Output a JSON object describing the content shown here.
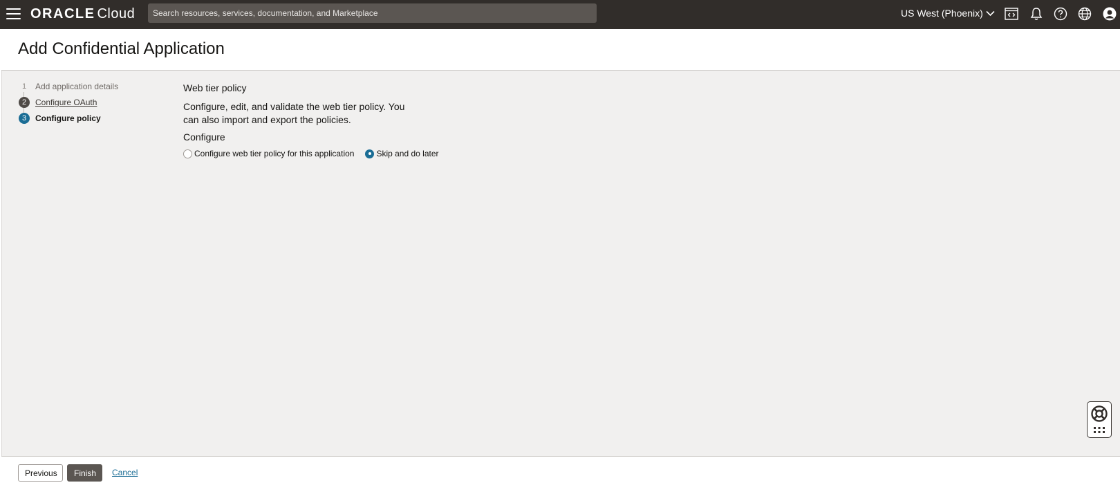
{
  "topbar": {
    "brand_oracle": "ORACLE",
    "brand_cloud": "Cloud",
    "search_placeholder": "Search resources, services, documentation, and Marketplace",
    "region": "US West (Phoenix)",
    "icons": [
      "menu-icon",
      "code-editor-icon",
      "bell-icon",
      "help-icon",
      "globe-icon",
      "user-profile-icon"
    ]
  },
  "header": {
    "title": "Add Confidential Application"
  },
  "steps": [
    {
      "number": "1",
      "label": "Add application details"
    },
    {
      "number": "2",
      "label": "Configure OAuth"
    },
    {
      "number": "3",
      "label": "Configure policy"
    }
  ],
  "main": {
    "section_title": "Web tier policy",
    "description": "Configure, edit, and validate the web tier policy. You can also import and export the policies.",
    "configure_label": "Configure",
    "radio_options": [
      {
        "label": "Configure web tier policy for this application",
        "selected": false
      },
      {
        "label": "Skip and do later",
        "selected": true
      }
    ]
  },
  "footer": {
    "previous_label": "Previous",
    "finish_label": "Finish",
    "cancel_label": "Cancel"
  },
  "colors": {
    "topbar_bg": "#312d2a",
    "accent": "#1b6d95",
    "finish_button": "#5b5652"
  }
}
